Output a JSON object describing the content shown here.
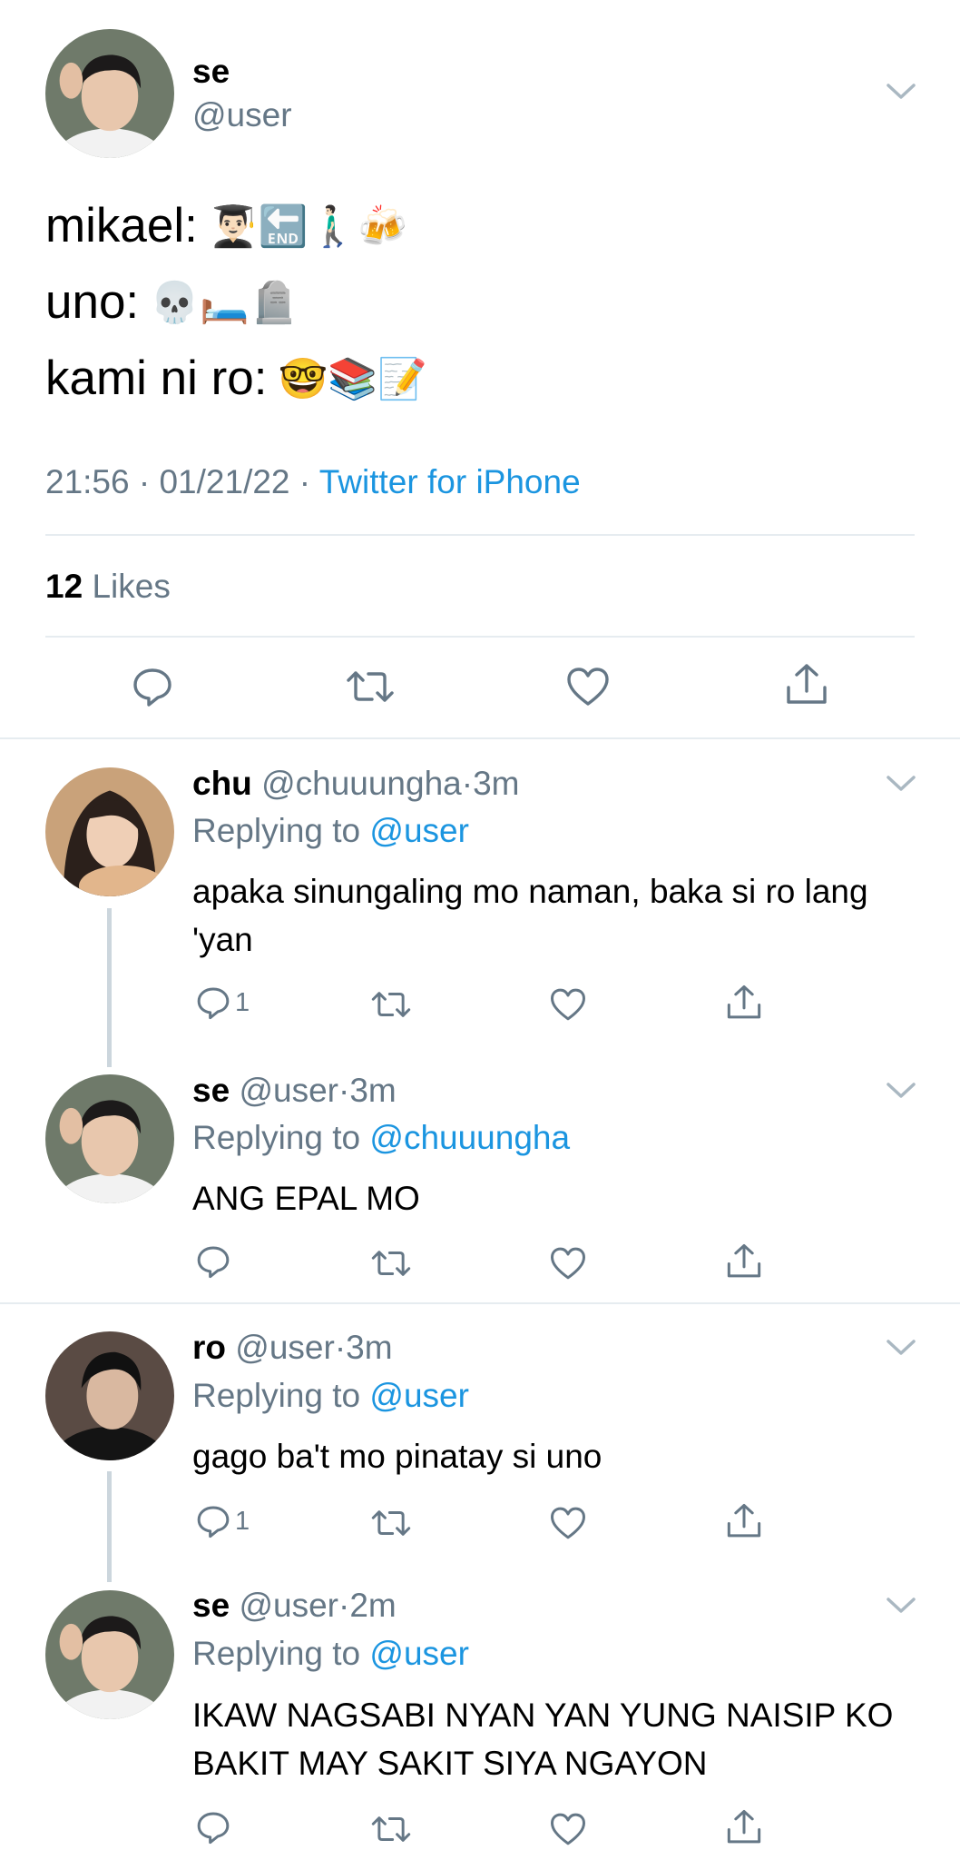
{
  "main_tweet": {
    "name": "se",
    "handle": "@user",
    "lines": [
      {
        "label": "mikael:",
        "emojis": "👨🏻‍🎓🔚🚶🏻‍♂️🍻"
      },
      {
        "label": "uno:",
        "emojis": "💀🛏️🪦"
      },
      {
        "label": "kami ni ro:",
        "emojis": "🤓📚📝"
      }
    ],
    "time": "21:56",
    "date": "01/21/22",
    "source": "Twitter for iPhone",
    "likes_count": "12",
    "likes_label": "Likes"
  },
  "replies": [
    {
      "name": "chu",
      "handle": "@chuuungha",
      "time": "3m",
      "replying_label": "Replying to",
      "replying_to": "@user",
      "text": "apaka sinungaling mo naman, baka si ro lang 'yan",
      "reply_count": "1"
    },
    {
      "name": "se",
      "handle": "@user",
      "time": "3m",
      "replying_label": "Replying to",
      "replying_to": "@chuuungha",
      "text": "ANG EPAL MO",
      "reply_count": ""
    },
    {
      "name": "ro",
      "handle": "@user",
      "time": "3m",
      "replying_label": "Replying to",
      "replying_to": "@user",
      "text": "gago ba't mo pinatay si uno",
      "reply_count": "1"
    },
    {
      "name": "se",
      "handle": "@user",
      "time": "2m",
      "replying_label": "Replying to",
      "replying_to": "@user",
      "text": "IKAW NAGSABI NYAN YAN YUNG NAISIP KO BAKIT MAY SAKIT SIYA NGAYON",
      "reply_count": ""
    }
  ],
  "dot": "·",
  "colors": {
    "accent": "#1b95e0",
    "secondary": "#657786",
    "divider": "#e6ecf0",
    "thread": "#ccd6dd"
  },
  "icons": [
    "reply-icon",
    "retweet-icon",
    "like-icon",
    "share-icon",
    "chevron-down-icon"
  ]
}
